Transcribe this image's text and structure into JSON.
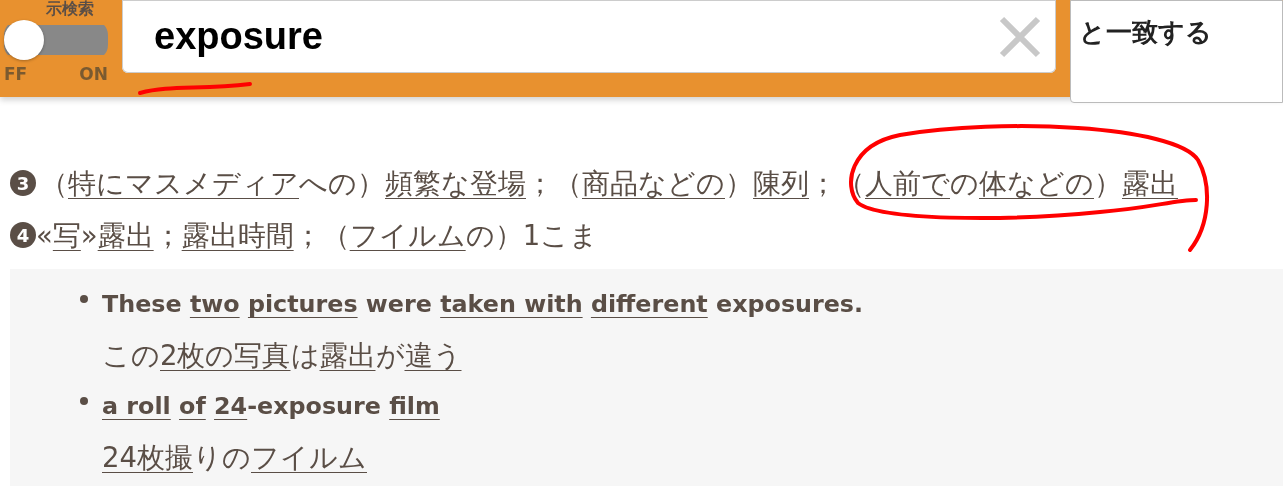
{
  "header": {
    "toggle": {
      "label": "示検索",
      "off_label": "FF",
      "on_label": "ON",
      "on": false
    },
    "search": {
      "value": "exposure"
    },
    "match_select": {
      "value": "と一致する"
    }
  },
  "senses": [
    {
      "number": "3",
      "segments": [
        {
          "text": "（",
          "kind": "plain"
        },
        {
          "text": "特にマスメディア",
          "kind": "link"
        },
        {
          "text": "への）",
          "kind": "plain"
        },
        {
          "text": "頻繁な登場",
          "kind": "link"
        },
        {
          "text": "；（",
          "kind": "plain"
        },
        {
          "text": "商品などの",
          "kind": "link"
        },
        {
          "text": "）",
          "kind": "plain"
        },
        {
          "text": "陳列",
          "kind": "link"
        },
        {
          "text": "；（",
          "kind": "plain"
        },
        {
          "text": "人前で",
          "kind": "link"
        },
        {
          "text": "の",
          "kind": "plain"
        },
        {
          "text": "体などの",
          "kind": "link"
        },
        {
          "text": "）",
          "kind": "plain"
        },
        {
          "text": "露出",
          "kind": "link"
        }
      ]
    },
    {
      "number": "4",
      "segments": [
        {
          "text": "«",
          "kind": "plain"
        },
        {
          "text": "写",
          "kind": "link"
        },
        {
          "text": "»",
          "kind": "plain"
        },
        {
          "text": "露出",
          "kind": "link"
        },
        {
          "text": "；",
          "kind": "plain"
        },
        {
          "text": "露出時間",
          "kind": "link"
        },
        {
          "text": "；（",
          "kind": "plain"
        },
        {
          "text": "フイルム",
          "kind": "link"
        },
        {
          "text": "の）1こま",
          "kind": "plain"
        }
      ]
    }
  ],
  "examples": [
    {
      "english": [
        {
          "text": "These ",
          "kind": "plain"
        },
        {
          "text": "two",
          "kind": "link"
        },
        {
          "text": "pictures",
          "kind": "link",
          "space_before": true
        },
        {
          "text": " were ",
          "kind": "plain"
        },
        {
          "text": "taken with",
          "kind": "link"
        },
        {
          "text": "different",
          "kind": "link",
          "space_before": true
        },
        {
          "text": " exposures.",
          "kind": "plain"
        }
      ],
      "japanese": [
        {
          "text": "この",
          "kind": "plain"
        },
        {
          "text": "2枚の写真",
          "kind": "link"
        },
        {
          "text": "は",
          "kind": "plain"
        },
        {
          "text": "露出",
          "kind": "link"
        },
        {
          "text": "が",
          "kind": "plain"
        },
        {
          "text": "違う",
          "kind": "link"
        }
      ]
    },
    {
      "english": [
        {
          "text": "a roll",
          "kind": "link"
        },
        {
          "text": "of",
          "kind": "link",
          "space_before": true
        },
        {
          "text": "24",
          "kind": "link",
          "space_before": true
        },
        {
          "text": "-exposure ",
          "kind": "plain"
        },
        {
          "text": "film",
          "kind": "link"
        }
      ],
      "japanese": [
        {
          "text": "24枚撮",
          "kind": "link"
        },
        {
          "text": "りの",
          "kind": "plain"
        },
        {
          "text": "フイルム",
          "kind": "link"
        }
      ]
    }
  ]
}
